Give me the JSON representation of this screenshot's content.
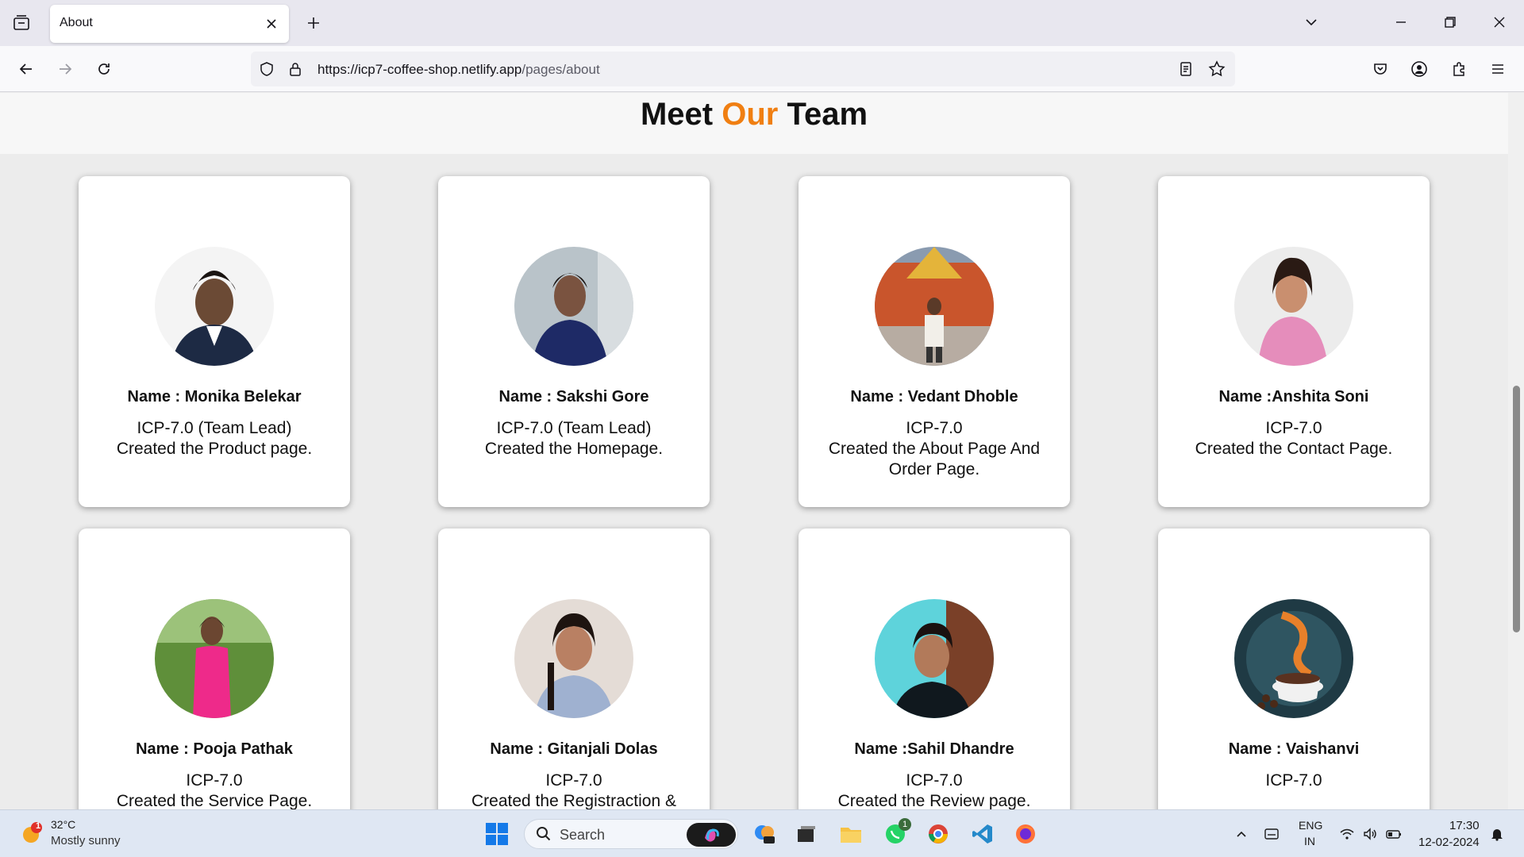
{
  "browser": {
    "tab_title": "About",
    "url_host": "https://icp7-coffee-shop.netlify.app",
    "url_path": "/pages/about"
  },
  "page": {
    "title_part1": "Meet",
    "title_accent": "Our",
    "title_part2": "Team",
    "accent_color": "#f07f12"
  },
  "team": [
    {
      "name": "Name : Monika Belekar",
      "role": "ICP-7.0 (Team Lead)",
      "desc": "Created the Product page.",
      "avatar": "portrait-photo"
    },
    {
      "name": "Name : Sakshi Gore",
      "role": "ICP-7.0 (Team Lead)",
      "desc": "Created the Homepage.",
      "avatar": "portrait-photo"
    },
    {
      "name": "Name : Vedant Dhoble",
      "role": "ICP-7.0",
      "desc": "Created the About Page And Order Page.",
      "avatar": "portrait-photo"
    },
    {
      "name": "Name :Anshita Soni",
      "role": "ICP-7.0",
      "desc": "Created the Contact Page.",
      "avatar": "portrait-photo"
    },
    {
      "name": "Name : Pooja Pathak",
      "role": "ICP-7.0",
      "desc": "Created the Service Page.",
      "avatar": "portrait-photo"
    },
    {
      "name": "Name : Gitanjali Dolas",
      "role": "ICP-7.0",
      "desc": "Created the Registraction &",
      "avatar": "portrait-photo"
    },
    {
      "name": "Name :Sahil Dhandre",
      "role": "ICP-7.0",
      "desc": "Created the Review page.",
      "avatar": "portrait-photo"
    },
    {
      "name": "Name : Vaishanvi",
      "role": "ICP-7.0",
      "desc": "",
      "avatar": "coffee-cup-image"
    }
  ],
  "taskbar": {
    "weather_temp": "32°C",
    "weather_desc": "Mostly sunny",
    "weather_badge": "1",
    "search_placeholder": "Search",
    "whatsapp_badge": "1",
    "lang_line1": "ENG",
    "lang_line2": "IN",
    "time": "17:30",
    "date": "12-02-2024"
  }
}
